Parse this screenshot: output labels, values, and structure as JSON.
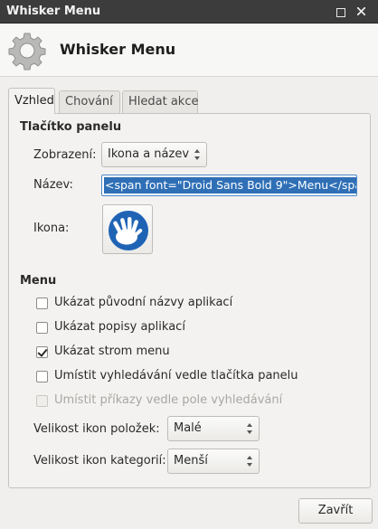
{
  "window": {
    "title": "Whisker Menu"
  },
  "header": {
    "title": "Whisker Menu",
    "icon": "gear-icon"
  },
  "tabs": [
    {
      "label": "Vzhled",
      "active": true
    },
    {
      "label": "Chování",
      "active": false
    },
    {
      "label": "Hledat akce",
      "active": false
    }
  ],
  "panel_button": {
    "section_title": "Tlačítko panelu",
    "display_label": "Zobrazení:",
    "display_value": "Ikona a název",
    "name_label": "Název:",
    "name_value": "<span font=\"Droid Sans Bold 9\">Menu</span>",
    "icon_label": "Ikona:",
    "icon": "xubuntu-logo-icon"
  },
  "menu": {
    "section_title": "Menu",
    "options": [
      {
        "label": "Ukázat původní názvy aplikací",
        "checked": false,
        "enabled": true
      },
      {
        "label": "Ukázat popisy aplikací",
        "checked": false,
        "enabled": true
      },
      {
        "label": "Ukázat strom menu",
        "checked": true,
        "enabled": true
      },
      {
        "label": "Umístit vyhledávání vedle tlačítka panelu",
        "checked": false,
        "enabled": true
      },
      {
        "label": "Umístit příkazy vedle pole vyhledávání",
        "checked": false,
        "enabled": false
      }
    ],
    "item_icon_size_label": "Velikost ikon položek:",
    "item_icon_size_value": "Malé",
    "category_icon_size_label": "Velikost ikon kategorií:",
    "category_icon_size_value": "Menší"
  },
  "footer": {
    "close_label": "Zavřít"
  },
  "colors": {
    "titlebar": "#3c3c3c",
    "selection": "#2f6fb6",
    "logo_blue": "#1f63b5"
  }
}
